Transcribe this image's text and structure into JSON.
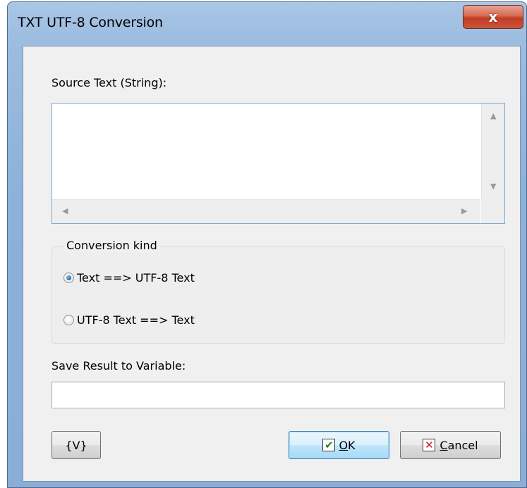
{
  "window": {
    "title": "TXT UTF-8 Conversion",
    "close_glyph": "x"
  },
  "source": {
    "label": "Source Text (String):",
    "value": ""
  },
  "conversion": {
    "legend": "Conversion kind",
    "options": [
      {
        "label": "Text ==> UTF-8 Text",
        "checked": true
      },
      {
        "label": "UTF-8 Text ==> Text",
        "checked": false
      }
    ]
  },
  "result": {
    "label": "Save Result to Variable:",
    "value": ""
  },
  "buttons": {
    "variables_label": "{V}",
    "ok_mnemonic": "O",
    "ok_rest": "K",
    "cancel_mnemonic": "C",
    "cancel_rest": "ancel"
  },
  "icons": {
    "close": "close-icon",
    "ok": "check-icon",
    "cancel": "x-icon"
  },
  "colors": {
    "frame": "#8db1d8",
    "client_bg": "#f0f0f0",
    "close_button": "#c9553b",
    "ok_check": "#1f8a1f",
    "cancel_x": "#cc1a1a"
  }
}
